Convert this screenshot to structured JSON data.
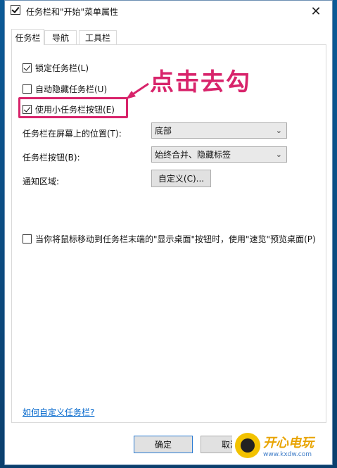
{
  "window": {
    "title": "任务栏和\"开始\"菜单属性",
    "close_glyph": "✕"
  },
  "tabs": [
    "任务栏",
    "导航",
    "工具栏"
  ],
  "options": {
    "lock_taskbar": "锁定任务栏(L)",
    "autohide": "自动隐藏任务栏(U)",
    "small_buttons": "使用小任务栏按钮(E)",
    "peek": "当你将鼠标移动到任务栏末端的\"显示桌面\"按钮时，使用\"速览\"预览桌面(P)"
  },
  "annotation": "点击去勾",
  "position": {
    "label": "任务栏在屏幕上的位置(T):",
    "value": "底部"
  },
  "buttons_setting": {
    "label": "任务栏按钮(B):",
    "value": "始终合并、隐藏标签"
  },
  "notify": {
    "label": "通知区域:",
    "button": "自定义(C)..."
  },
  "link": "如何自定义任务栏?",
  "footer": {
    "ok": "确定",
    "cancel": "取消"
  },
  "watermark": {
    "main": "开心电玩",
    "sub": "www.kxdw.com"
  },
  "colors": {
    "highlight": "#d8246b",
    "link": "#0066cc",
    "default_button_border": "#2b7cd3"
  }
}
